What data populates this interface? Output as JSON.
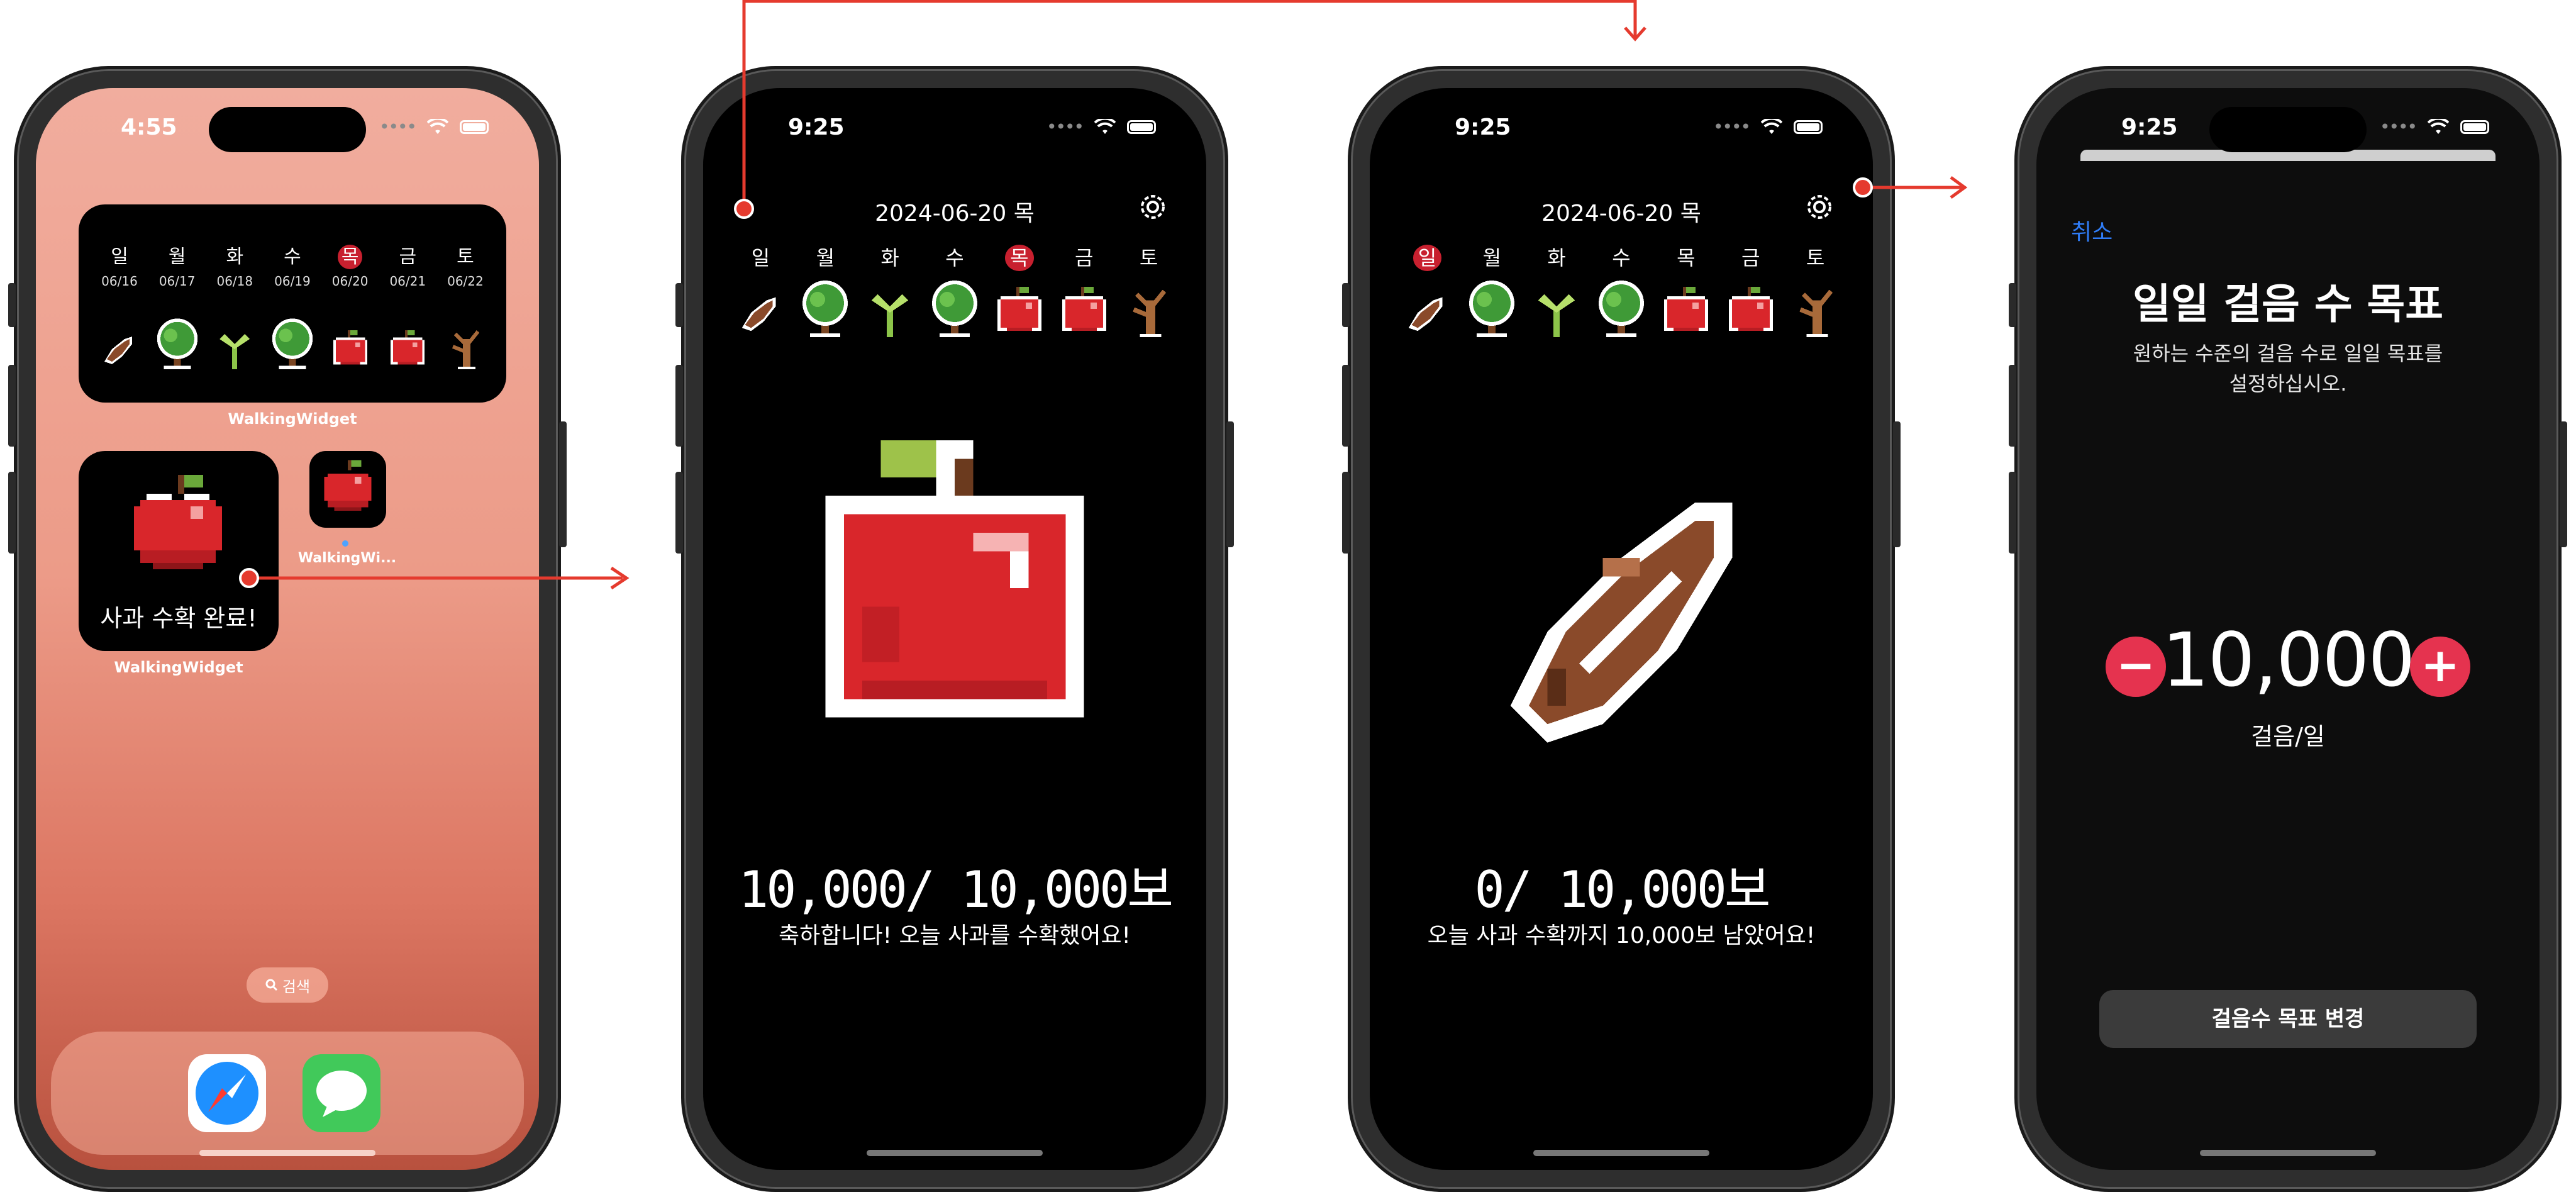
{
  "colors": {
    "accent_red": "#e5334f",
    "ios_blue": "#2f7cf6",
    "arrow": "#e53a2e"
  },
  "phone1": {
    "time": "4:55",
    "week_widget": {
      "days": [
        {
          "name": "일",
          "date": "06/16",
          "sprite": "seed-icon"
        },
        {
          "name": "월",
          "date": "06/17",
          "sprite": "tree-icon"
        },
        {
          "name": "화",
          "date": "06/18",
          "sprite": "sprout-icon"
        },
        {
          "name": "수",
          "date": "06/19",
          "sprite": "tree-icon"
        },
        {
          "name": "목",
          "date": "06/20",
          "sprite": "apple-icon",
          "selected": true
        },
        {
          "name": "금",
          "date": "06/21",
          "sprite": "apple-icon"
        },
        {
          "name": "토",
          "date": "06/22",
          "sprite": "dead-tree-icon"
        }
      ],
      "label": "WalkingWidget"
    },
    "medium_widget": {
      "text": "사과 수확 완료!",
      "label": "WalkingWidget"
    },
    "small_widget": {
      "label": "WalkingWi..."
    },
    "search": "검색",
    "dock": [
      "safari-icon",
      "messages-icon"
    ]
  },
  "phone2": {
    "time": "9:25",
    "header_date": "2024-06-20 목",
    "days": [
      "일",
      "월",
      "화",
      "수",
      "목",
      "금",
      "토"
    ],
    "selected_index": 4,
    "count": "10,000/ 10,000보",
    "message": "축하합니다! 오늘 사과를 수확했어요!"
  },
  "phone3": {
    "time": "9:25",
    "header_date": "2024-06-20 목",
    "days": [
      "일",
      "월",
      "화",
      "수",
      "목",
      "금",
      "토"
    ],
    "selected_index": 0,
    "count": "0/ 10,000보",
    "message": "오늘 사과 수확까지 10,000보 남았어요!"
  },
  "phone4": {
    "time": "9:25",
    "cancel": "취소",
    "title": "일일 걸음 수 목표",
    "description": "원하는 수준의 걸음 수로 일일 목표를 설정하십시오.",
    "goal_value": "10,000",
    "minus": "−",
    "plus": "+",
    "unit": "걸음/일",
    "confirm": "걸음수 목표 변경"
  }
}
